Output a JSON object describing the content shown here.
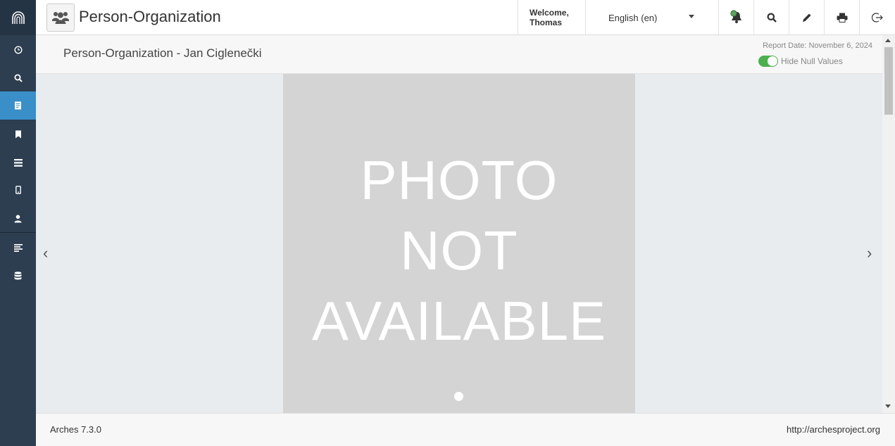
{
  "sidebar": {
    "logo_icon": "arches-logo-icon",
    "items": [
      {
        "name": "sidebar-item-dashboard",
        "icon": "clock-icon"
      },
      {
        "name": "sidebar-item-search",
        "icon": "search-icon"
      },
      {
        "name": "sidebar-item-report",
        "icon": "report-icon",
        "active": true
      },
      {
        "name": "sidebar-item-bookmarks",
        "icon": "bookmark-icon"
      },
      {
        "name": "sidebar-item-graph-designer",
        "icon": "list-icon"
      },
      {
        "name": "sidebar-item-mobile",
        "icon": "mobile-icon"
      },
      {
        "name": "sidebar-item-profile",
        "icon": "user-icon"
      },
      {
        "name": "sidebar-item-plugins",
        "icon": "align-left-icon"
      },
      {
        "name": "sidebar-item-database",
        "icon": "database-icon"
      }
    ]
  },
  "header": {
    "resource_icon": "users-icon",
    "title": "Person-Organization",
    "welcome_line1": "Welcome,",
    "welcome_line2": "Thomas",
    "language": "English (en)",
    "buttons": [
      "notifications-bell-icon",
      "search-icon",
      "edit-pencil-icon",
      "print-icon",
      "logout-icon"
    ]
  },
  "report": {
    "title": "Person-Organization - Jan Ciglenečki",
    "report_date": "Report Date: November 6, 2024",
    "hide_null_label": "Hide Null Values",
    "hide_null_enabled": true
  },
  "carousel": {
    "photo_text": [
      "PHOTO",
      "NOT",
      "AVAILABLE"
    ],
    "prev_arrow": "‹",
    "next_arrow": "›"
  },
  "footer": {
    "version": "Arches 7.3.0",
    "link": "http://archesproject.org"
  },
  "colors": {
    "sidebar_bg": "#2c3e50",
    "sidebar_active": "#3a8fc8",
    "toggle_on": "#4caf50",
    "photo_placeholder": "#d4d4d4",
    "carousel_bg": "#e9ecef"
  }
}
